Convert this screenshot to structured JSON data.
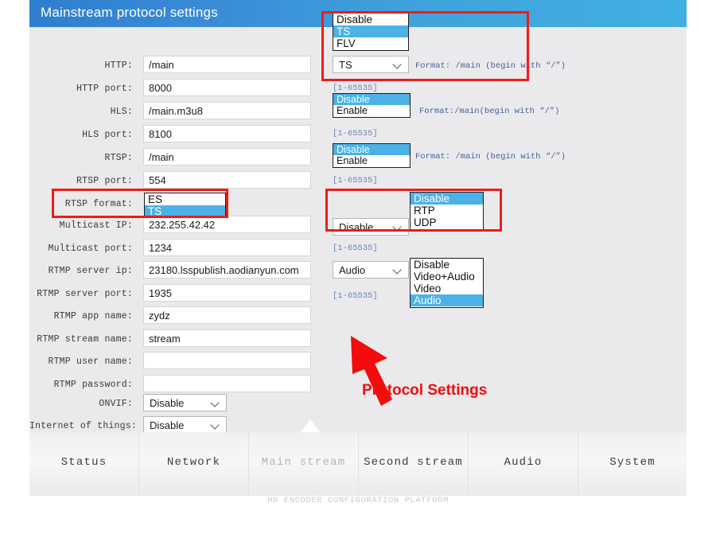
{
  "header": {
    "title": "Mainstream protocol settings"
  },
  "form": {
    "rows": [
      {
        "label": "HTTP:",
        "value": "/main"
      },
      {
        "label": "HTTP port:",
        "value": "8000"
      },
      {
        "label": "HLS:",
        "value": "/main.m3u8"
      },
      {
        "label": "HLS port:",
        "value": "8100"
      },
      {
        "label": "RTSP:",
        "value": "/main"
      },
      {
        "label": "RTSP port:",
        "value": "554"
      },
      {
        "label": "RTSP format:",
        "value": ""
      },
      {
        "label": "Multicast IP:",
        "value": "232.255.42.42"
      },
      {
        "label": "Multicast port:",
        "value": "1234"
      },
      {
        "label": "RTMP server ip:",
        "value": "23180.lsspublish.aodianyun.com"
      },
      {
        "label": "RTMP server port:",
        "value": "1935"
      },
      {
        "label": "RTMP app name:",
        "value": "zydz"
      },
      {
        "label": "RTMP stream name:",
        "value": "stream"
      },
      {
        "label": "RTMP user name:",
        "value": ""
      },
      {
        "label": "RTMP password:",
        "value": ""
      },
      {
        "label": "ONVIF:",
        "value": ""
      },
      {
        "label": "Internet of things:",
        "value": ""
      }
    ]
  },
  "selects": {
    "http_protocol": {
      "value": "TS",
      "options": [
        "Disable",
        "TS",
        "FLV"
      ]
    },
    "rtsp_format": {
      "options": [
        "ES",
        "TS"
      ],
      "selected": "TS"
    },
    "multicast": {
      "value": "Disable",
      "options": [
        "Disable",
        "RTP",
        "UDP"
      ]
    },
    "rtmp_stream": {
      "value": "Audio",
      "options": [
        "Disable",
        "Video+Audio",
        "Video",
        "Audio"
      ]
    },
    "hls_enable": {
      "options": [
        "Disable",
        "Enable"
      ],
      "selected": "Disable"
    },
    "rtsp_enable": {
      "options": [
        "Disable",
        "Enable"
      ],
      "selected": "Disable"
    },
    "onvif": {
      "value": "Disable"
    },
    "iot": {
      "value": "Disable"
    }
  },
  "hints": {
    "range": "[1-65535]",
    "format_http": "Format: /main (begin with “/”)",
    "format_hls": "Format:/main(begin with “/”)",
    "format_rtsp": "Format: /main (begin with “/”)"
  },
  "annotation": {
    "label": "Protocol Settings",
    "color": "#f40b0b"
  },
  "footer": {
    "nav": [
      {
        "label": "Status",
        "active": false
      },
      {
        "label": "Network",
        "active": false
      },
      {
        "label": "Main stream",
        "active": true
      },
      {
        "label": "Second stream",
        "active": false
      },
      {
        "label": "Audio",
        "active": false
      },
      {
        "label": "System",
        "active": false
      }
    ],
    "platform": "HD ENCODER CONFIGURATION PLATFORM"
  }
}
